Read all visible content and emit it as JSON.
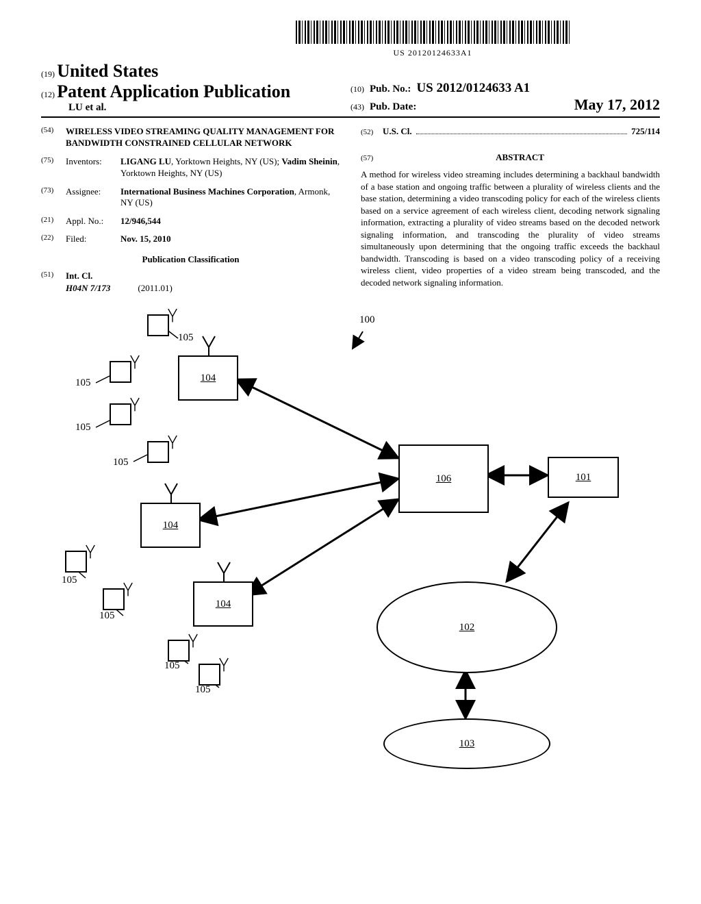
{
  "barcode_number": "US 20120124633A1",
  "header": {
    "tag19": "(19)",
    "country": "United States",
    "tag12": "(12)",
    "doctype": "Patent Application Publication",
    "authors": "LU et al.",
    "tag10": "(10)",
    "pubno_label": "Pub. No.:",
    "pubno_value": "US 2012/0124633 A1",
    "tag43": "(43)",
    "pubdate_label": "Pub. Date:",
    "pubdate_value": "May 17, 2012"
  },
  "left": {
    "f54_num": "(54)",
    "f54_title": "WIRELESS VIDEO STREAMING QUALITY MANAGEMENT FOR BANDWIDTH CONSTRAINED CELLULAR NETWORK",
    "f75_num": "(75)",
    "f75_label": "Inventors:",
    "f75_val_name1": "LIGANG LU",
    "f75_val_rest1": ", Yorktown Heights, NY (US); ",
    "f75_val_name2": "Vadim Sheinin",
    "f75_val_rest2": ", Yorktown Heights, NY (US)",
    "f73_num": "(73)",
    "f73_label": "Assignee:",
    "f73_val_bold": "International Business Machines Corporation",
    "f73_val_rest": ", Armonk, NY (US)",
    "f21_num": "(21)",
    "f21_label": "Appl. No.:",
    "f21_val": "12/946,544",
    "f22_num": "(22)",
    "f22_label": "Filed:",
    "f22_val": "Nov. 15, 2010",
    "pubclass_title": "Publication Classification",
    "f51_num": "(51)",
    "f51_label": "Int. Cl.",
    "f51_code": "H04N 7/173",
    "f51_year": "(2011.01)"
  },
  "right": {
    "f52_num": "(52)",
    "f52_label": "U.S. Cl.",
    "f52_val": "725/114",
    "f57_num": "(57)",
    "abstract_label": "ABSTRACT",
    "abstract_text": "A method for wireless video streaming includes determining a backhaul bandwidth of a base station and ongoing traffic between a plurality of wireless clients and the base station, determining a video transcoding policy for each of the wireless clients based on a service agreement of each wireless client, decoding network signaling information, extracting a plurality of video streams based on the decoded network signaling information, and transcoding the plurality of video streams simultaneously upon determining that the ongoing traffic exceeds the backhaul bandwidth. Transcoding is based on a video transcoding policy of a receiving wireless client, video properties of a video stream being transcoded, and the decoded network signaling information."
  },
  "figure": {
    "ref100": "100",
    "ref101": "101",
    "ref102": "102",
    "ref103": "103",
    "ref104": "104",
    "ref105": "105",
    "ref106": "106"
  }
}
